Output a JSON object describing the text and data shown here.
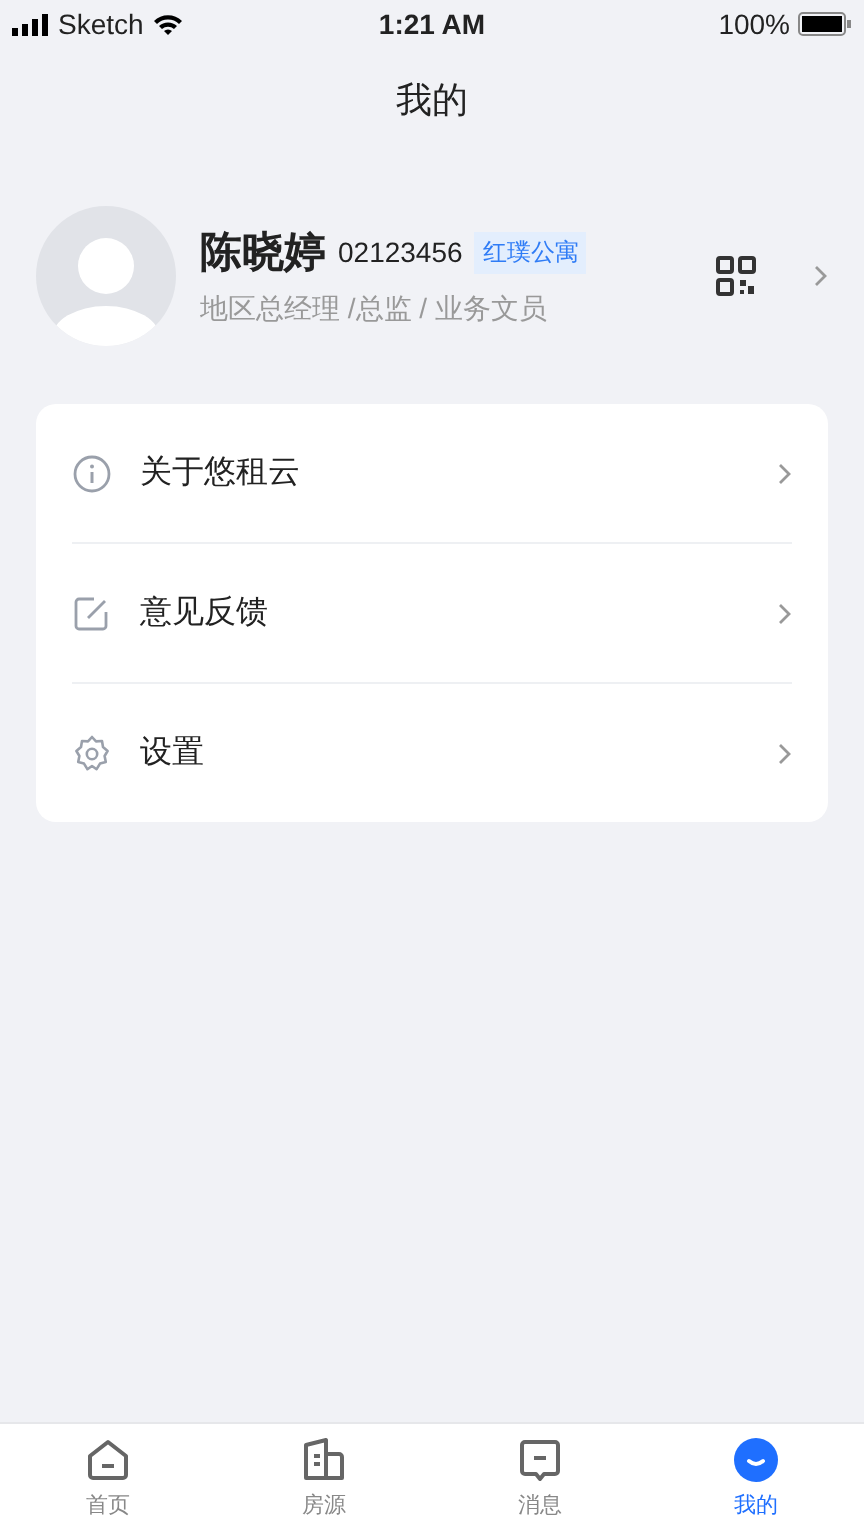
{
  "status_bar": {
    "carrier": "Sketch",
    "time": "1:21 AM",
    "battery": "100%"
  },
  "header": {
    "title": "我的"
  },
  "profile": {
    "name": "陈晓婷",
    "id": "02123456",
    "tag": "红璞公寓",
    "roles": "地区总经理 /总监 / 业务文员"
  },
  "menu": [
    {
      "kind": "info",
      "label": "关于悠租云"
    },
    {
      "kind": "edit",
      "label": "意见反馈"
    },
    {
      "kind": "settings",
      "label": "设置"
    }
  ],
  "tabs": [
    {
      "kind": "home",
      "label": "首页",
      "selected": false
    },
    {
      "kind": "building",
      "label": "房源",
      "selected": false
    },
    {
      "kind": "message",
      "label": "消息",
      "selected": false
    },
    {
      "kind": "me",
      "label": "我的",
      "selected": true
    }
  ]
}
